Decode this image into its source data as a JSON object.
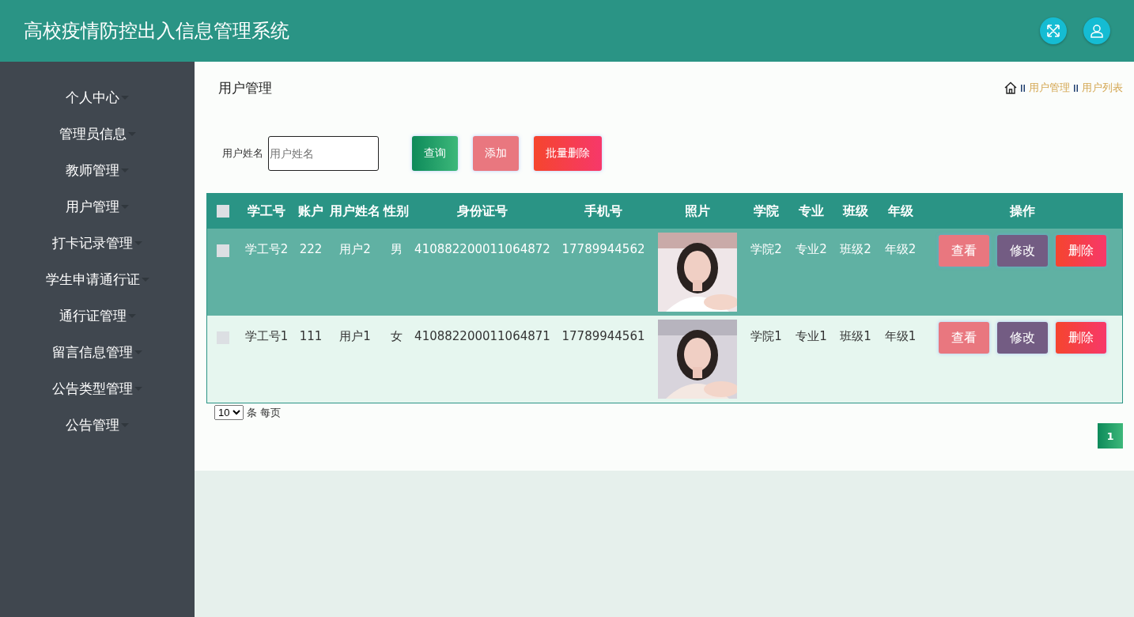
{
  "header": {
    "title": "高校疫情防控出入信息管理系统"
  },
  "sidebar": {
    "items": [
      {
        "label": "个人中心"
      },
      {
        "label": "管理员信息"
      },
      {
        "label": "教师管理"
      },
      {
        "label": "用户管理"
      },
      {
        "label": "打卡记录管理"
      },
      {
        "label": "学生申请通行证"
      },
      {
        "label": "通行证管理"
      },
      {
        "label": "留言信息管理"
      },
      {
        "label": "公告类型管理"
      },
      {
        "label": "公告管理"
      }
    ]
  },
  "page_title": "用户管理",
  "breadcrumb": [
    "用户管理",
    "用户列表"
  ],
  "search": {
    "label": "用户姓名",
    "placeholder": "用户姓名",
    "buttons": [
      {
        "label": "查询",
        "kind": "query"
      },
      {
        "label": "添加",
        "kind": "add"
      },
      {
        "label": "批量删除",
        "kind": "delete"
      }
    ]
  },
  "table": {
    "select_all": {
      "checked": false
    },
    "columns": [
      "学工号",
      "账户",
      "用户姓名",
      "性别",
      "身份证号",
      "手机号",
      "照片",
      "学院",
      "专业",
      "班级",
      "年级",
      "操作"
    ],
    "rows": [
      {
        "hovered": true,
        "checked": false,
        "cells": [
          "学工号2",
          "222",
          "用户2",
          "男",
          "410882200011064872",
          "17789944562",
          {
            "kind": "picture"
          },
          "学院2",
          "专业2",
          "班级2",
          "年级2"
        ],
        "actions": [
          {
            "label": "查看",
            "kind": "view"
          },
          {
            "label": "修改",
            "kind": "edit"
          },
          {
            "label": "删除",
            "kind": "delete"
          }
        ]
      },
      {
        "hovered": false,
        "checked": false,
        "cells": [
          "学工号1",
          "111",
          "用户1",
          "女",
          "410882200011064871",
          "17789944561",
          {
            "kind": "picture"
          },
          "学院1",
          "专业1",
          "班级1",
          "年级1"
        ],
        "actions": [
          {
            "label": "查看",
            "kind": "view"
          },
          {
            "label": "修改",
            "kind": "edit"
          },
          {
            "label": "删除",
            "kind": "delete"
          }
        ]
      }
    ]
  },
  "pagination": {
    "page_size": "10",
    "page_size_suffix": "条 每页",
    "pages": [
      {
        "label": "1",
        "selected": true
      }
    ]
  }
}
